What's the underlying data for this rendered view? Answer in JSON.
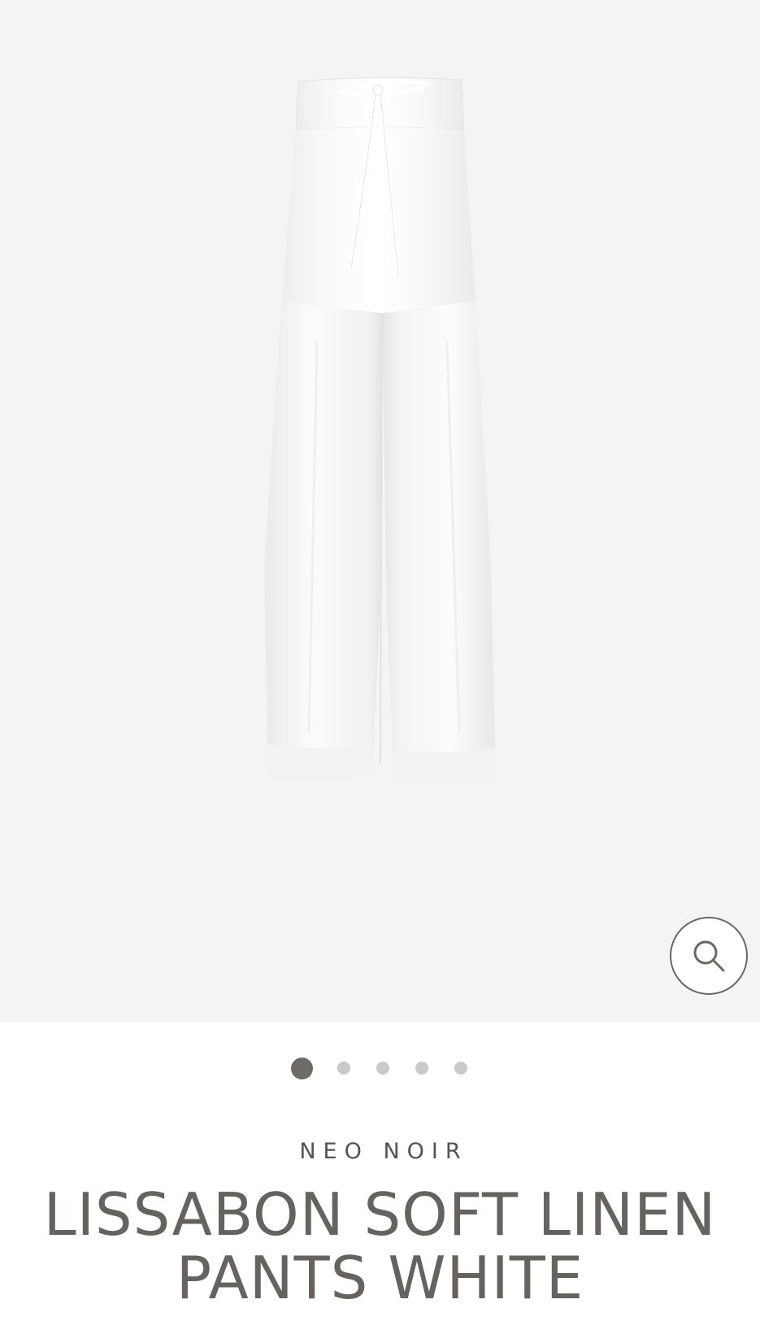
{
  "gallery": {
    "image_alt": "White linen wide-leg pants with drawstring",
    "zoom_icon": "search-icon",
    "dots_total": 5,
    "dots_active": 1
  },
  "product": {
    "brand": "NEO NOIR",
    "title_line1": "LISSABON SOFT LINEN",
    "title_line2": "PANTS WHITE"
  },
  "colors": {
    "gallery_bg": "#f4f4f4",
    "text": "#66625d",
    "dot_active": "#6e6b66",
    "dot_inactive": "#c9c9c9"
  }
}
